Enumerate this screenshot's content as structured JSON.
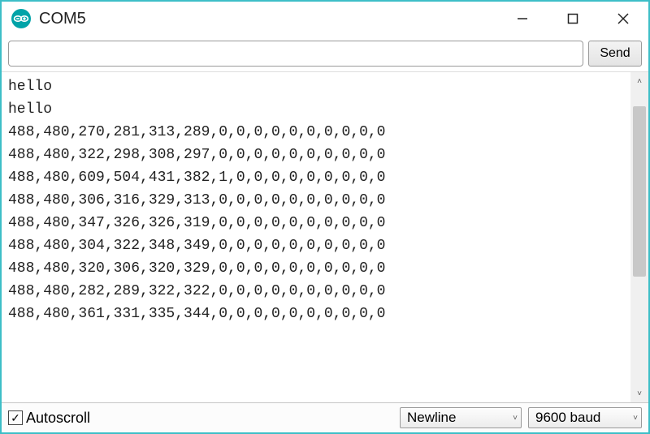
{
  "window": {
    "title": "COM5"
  },
  "input": {
    "value": "",
    "placeholder": ""
  },
  "toolbar": {
    "send_label": "Send"
  },
  "output_lines": [
    "hello",
    "hello",
    "488,480,270,281,313,289,0,0,0,0,0,0,0,0,0,0",
    "488,480,322,298,308,297,0,0,0,0,0,0,0,0,0,0",
    "488,480,609,504,431,382,1,0,0,0,0,0,0,0,0,0",
    "488,480,306,316,329,313,0,0,0,0,0,0,0,0,0,0",
    "488,480,347,326,326,319,0,0,0,0,0,0,0,0,0,0",
    "488,480,304,322,348,349,0,0,0,0,0,0,0,0,0,0",
    "488,480,320,306,320,329,0,0,0,0,0,0,0,0,0,0",
    "488,480,282,289,322,322,0,0,0,0,0,0,0,0,0,0",
    "488,480,361,331,335,344,0,0,0,0,0,0,0,0,0,0"
  ],
  "footer": {
    "autoscroll_label": "Autoscroll",
    "autoscroll_checked": true,
    "line_ending": "Newline",
    "baud": "9600 baud"
  },
  "icons": {
    "checkmark": "✓",
    "chevron_down": "˅",
    "scroll_up": "˄",
    "scroll_down": "˅"
  }
}
